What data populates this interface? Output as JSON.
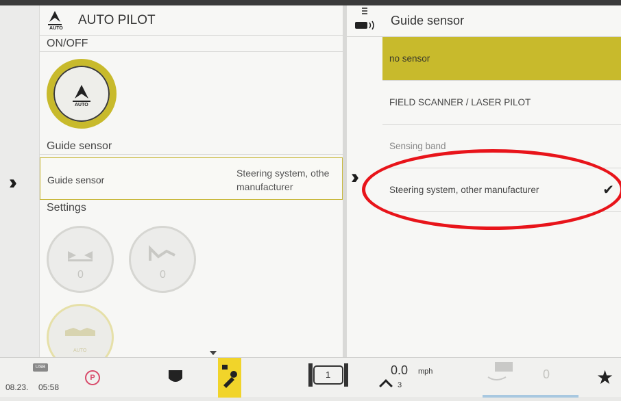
{
  "left_panel": {
    "title": "AUTO PILOT",
    "icon_caption": "AUTO",
    "onoff_label": "ON/OFF",
    "dial_caption": "AUTO",
    "guide_section": "Guide sensor",
    "guide_row_label": "Guide sensor",
    "guide_row_value_line1": "Steering system, othe",
    "guide_row_value_line2": "manufacturer",
    "settings_section": "Settings",
    "settings_dial1_value": "0",
    "settings_dial2_value": "0",
    "settings_dial3_caption": "AUTO"
  },
  "right_panel": {
    "title": "Guide sensor",
    "options": [
      {
        "label": "no sensor",
        "selected_highlight": true
      },
      {
        "label": "FIELD SCANNER / LASER PILOT"
      },
      {
        "label": "Sensing band"
      },
      {
        "label": "Steering system, other manufacturer",
        "checked": true
      }
    ]
  },
  "bottom_bar": {
    "usb_label": "USB",
    "date": "08.23.",
    "time": "05:58",
    "parking_label": "P",
    "speed_value": "0.0",
    "speed_unit": "mph",
    "speed_sub": "3",
    "gear_value": "1",
    "counter_value": "0"
  },
  "colors": {
    "accent": "#c8ba2c",
    "annotation_circle": "#e8141a"
  }
}
